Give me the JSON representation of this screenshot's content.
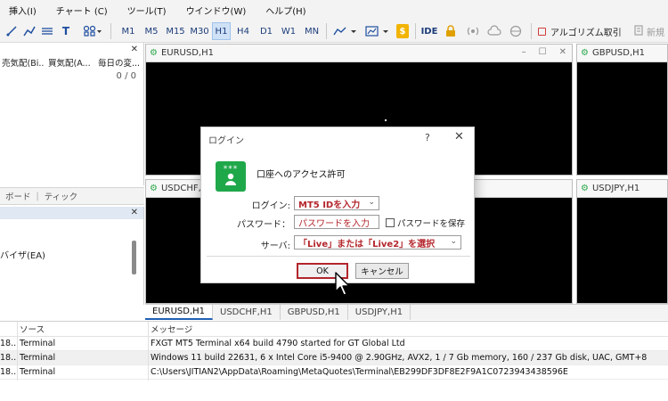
{
  "menu": [
    "挿入(I)",
    "チャート (C)",
    "ツール(T)",
    "ウインドウ(W)",
    "ヘルプ(H)"
  ],
  "toolbar": {
    "timeframes": [
      "M1",
      "M5",
      "M15",
      "M30",
      "H1",
      "H4",
      "D1",
      "W1",
      "MN"
    ],
    "active_timeframe": "H1",
    "ide_label": "IDE",
    "gold_label": "$",
    "algo_label": "アルゴリズム取引",
    "new_label": "新規"
  },
  "market_watch": {
    "headers": [
      "売気配(Bi...",
      "買気配(A...",
      "毎日の変..."
    ],
    "count": "0 / 0"
  },
  "left_tabs": [
    "ボード",
    "ティック"
  ],
  "navigator": {
    "item": "バイザ(EA)"
  },
  "charts": [
    {
      "name": "EURUSD,H1"
    },
    {
      "name": "GBPUSD,H1"
    },
    {
      "name": "USDCHF,H1"
    },
    {
      "name": "USDJPY,H1"
    }
  ],
  "chart_tabs": [
    "EURUSD,H1",
    "USDCHF,H1",
    "GBPUSD,H1",
    "USDJPY,H1"
  ],
  "active_chart_tab": "EURUSD,H1",
  "terminal": {
    "headers": {
      "source": "ソース",
      "message": "メッセージ"
    },
    "rows": [
      {
        "time": "18...",
        "source": "Terminal",
        "message": "FXGT MT5 Terminal x64 build 4790 started for GT Global Ltd"
      },
      {
        "time": "18...",
        "source": "Terminal",
        "message": "Windows 11 build 22631, 6 x Intel Core i5-9400  @ 2.90GHz, AVX2, 1 / 7 Gb memory, 160 / 237 Gb disk, UAC, GMT+8"
      },
      {
        "time": "18...",
        "source": "Terminal",
        "message": "C:\\Users\\JITIAN2\\AppData\\Roaming\\MetaQuotes\\Terminal\\EB299DF3DF8E2F9A1C0723943438596E"
      }
    ]
  },
  "login_dialog": {
    "title": "ログイン",
    "help": "?",
    "close": "✕",
    "avatar_stars": "***",
    "heading": "口座へのアクセス許可",
    "login_label": "ログイン:",
    "login_value": "MT5 IDを入力",
    "password_label": "パスワード：",
    "password_value": "パスワードを入力",
    "save_password_label": "パスワードを保存",
    "server_label": "サーバ:",
    "server_value": "「Live」または「Live2」を選択",
    "ok_label": "OK",
    "cancel_label": "キャンセル"
  }
}
